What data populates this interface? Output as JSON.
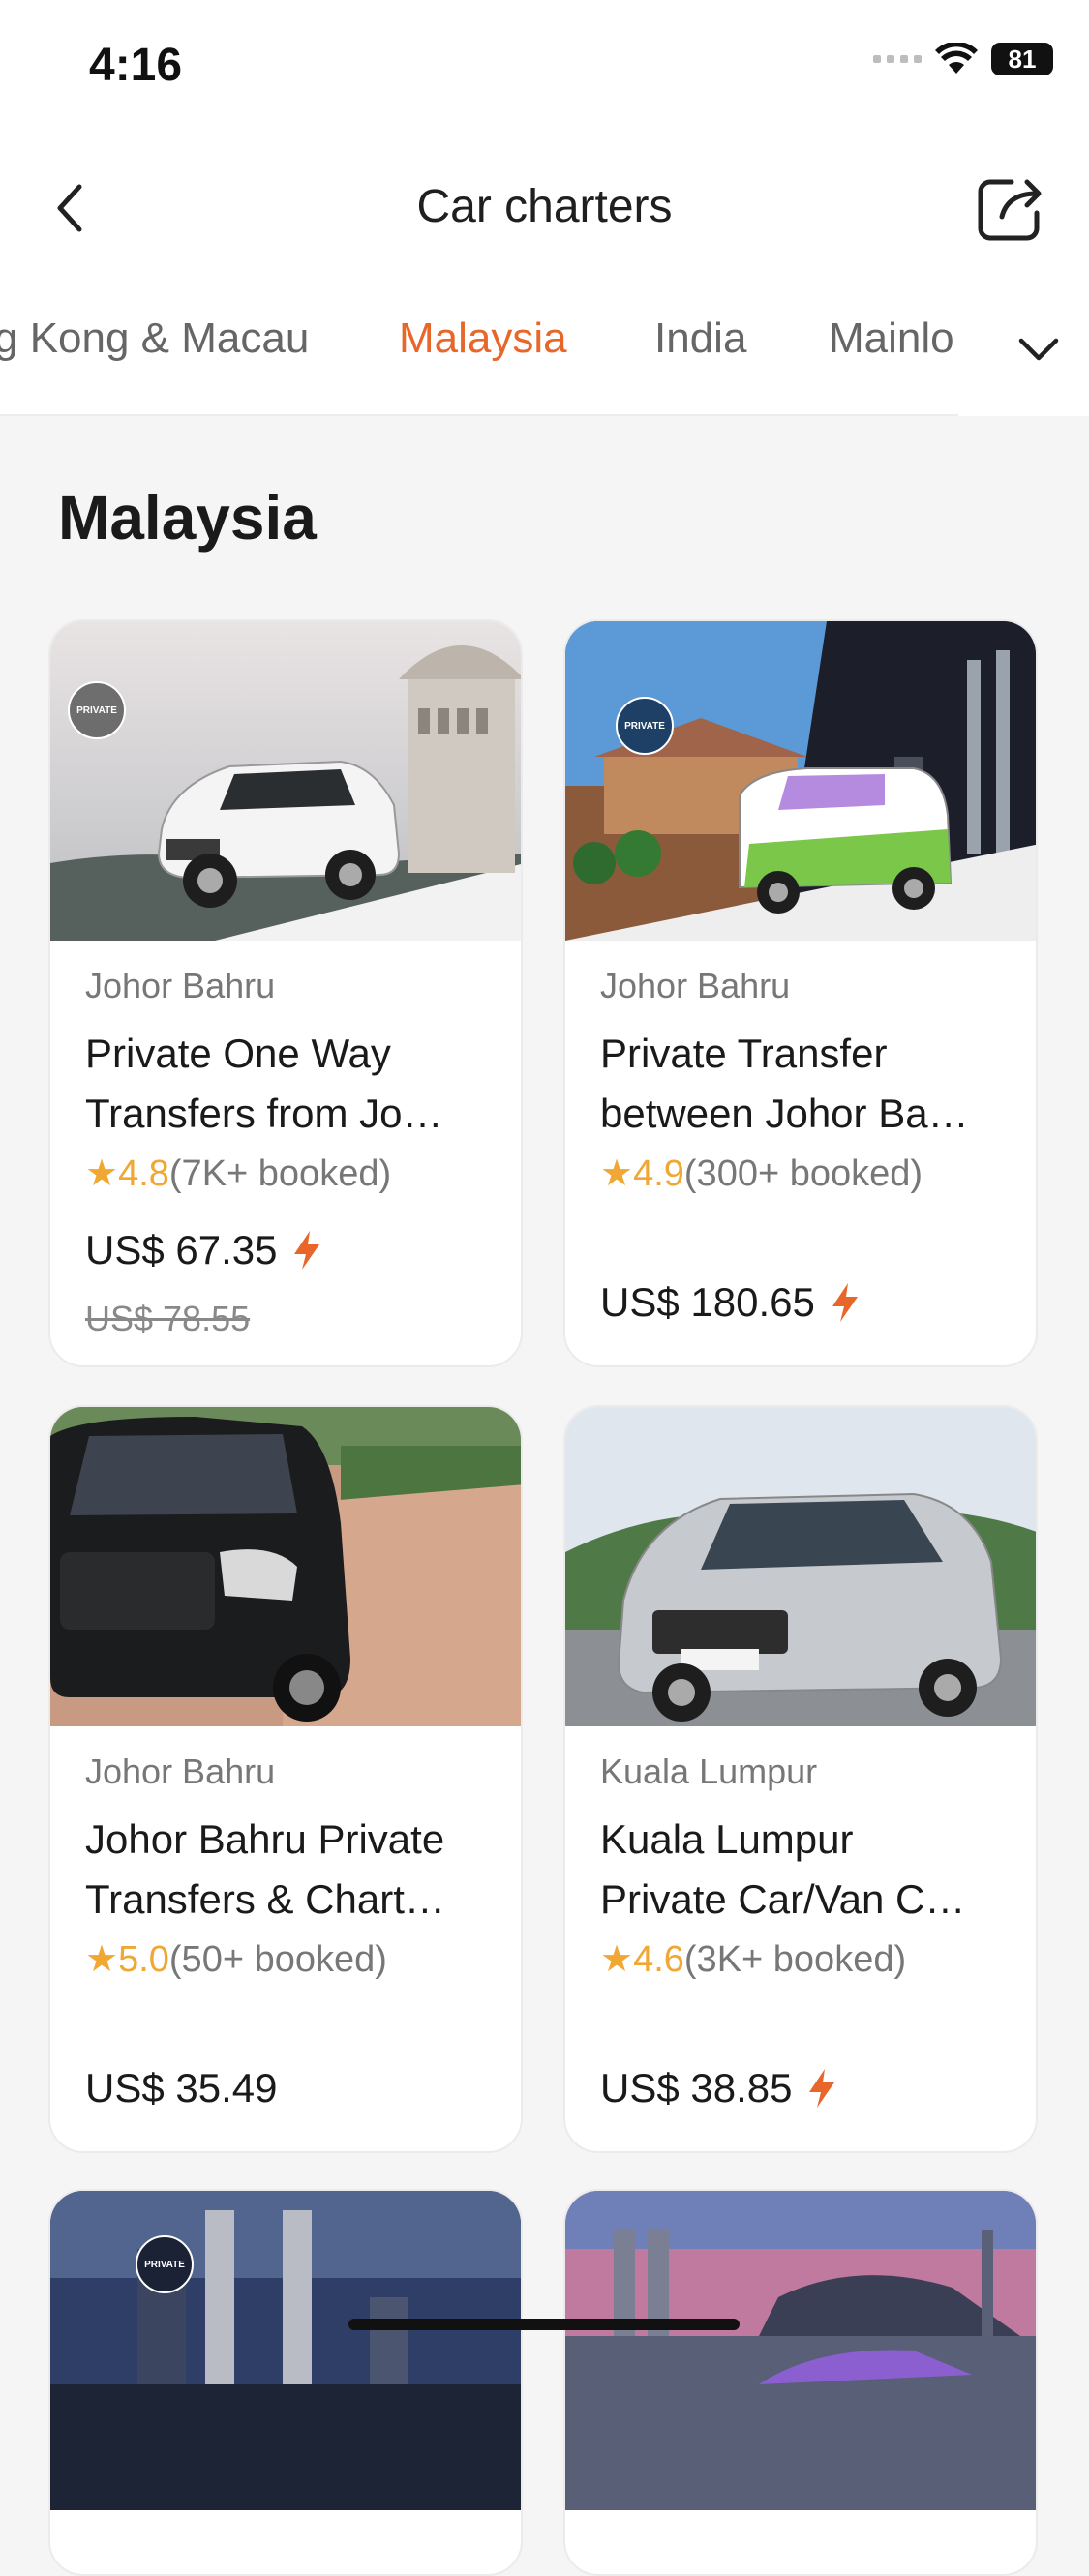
{
  "status_bar": {
    "time": "4:16",
    "battery": "81"
  },
  "nav": {
    "title": "Car charters"
  },
  "tabs": [
    {
      "label": "Hong Kong & Macau",
      "visible_text": "g Kong & Macau"
    },
    {
      "label": "Malaysia"
    },
    {
      "label": "India"
    },
    {
      "label": "Mainland",
      "visible_text": "Mainlo"
    }
  ],
  "active_tab": "Malaysia",
  "section": {
    "title": "Malaysia"
  },
  "cards": [
    {
      "location": "Johor Bahru",
      "title_line1": "Private One Way",
      "title_line2": "Transfers from Jo…",
      "rating": "4.8",
      "booked": "(7K+ booked)",
      "price": "US$ 67.35",
      "original_price": "US$ 78.55",
      "badge": "PRIVATE"
    },
    {
      "location": "Johor Bahru",
      "title_line1": "Private Transfer",
      "title_line2": "between Johor Ba…",
      "rating": "4.9",
      "booked": "(300+ booked)",
      "price": "US$ 180.65",
      "badge": "PRIVATE"
    },
    {
      "location": "Johor Bahru",
      "title_line1": "Johor Bahru Private",
      "title_line2": "Transfers & Chart…",
      "rating": "5.0",
      "booked": "(50+ booked)",
      "price": "US$ 35.49"
    },
    {
      "location": "Kuala Lumpur",
      "title_line1": "Kuala Lumpur",
      "title_line2": "Private Car/Van C…",
      "rating": "4.6",
      "booked": "(3K+ booked)",
      "price": "US$ 38.85"
    },
    {
      "badge": "PRIVATE"
    },
    {}
  ],
  "colors": {
    "accent": "#e8662a",
    "rating": "#f0a733"
  }
}
